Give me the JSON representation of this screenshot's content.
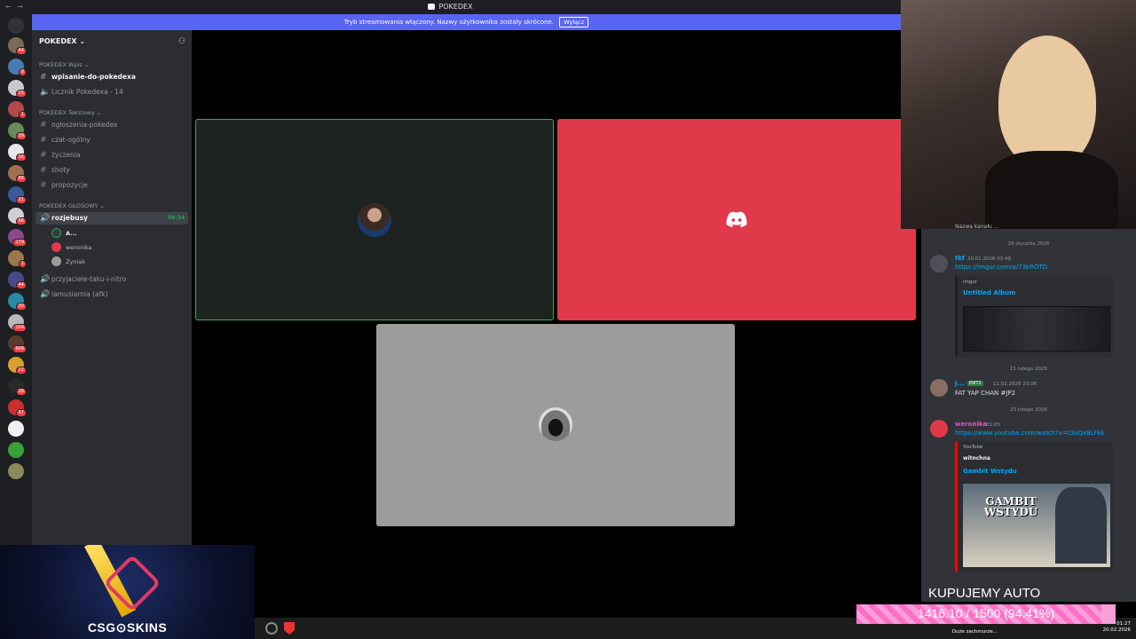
{
  "window": {
    "title": "POKEDEX"
  },
  "banner": {
    "text": "Tryb streamowania włączony. Nazwy użytkownika zostały skrócone.",
    "button": "Wyłącz"
  },
  "rail": {
    "badges": [
      "44",
      "8",
      "15",
      "1",
      "39",
      "16",
      "88",
      "31",
      "66",
      "179",
      "1",
      "44",
      "30",
      "104",
      "606",
      "22",
      "28",
      "57"
    ]
  },
  "sidebar": {
    "server_name": "POKEDEX",
    "categories": [
      {
        "label": "POKEDEX Wpis"
      },
      {
        "label": "POKEDEX Tekstowy"
      },
      {
        "label": "POKEDEX GŁOSOWY"
      }
    ],
    "channels": [
      {
        "label": "wpisanie-do-pokedexa"
      },
      {
        "label": "Licznik Pokedexa - 14"
      },
      {
        "label": "ogłoszenia-pokedex"
      },
      {
        "label": "czat-ogólny"
      },
      {
        "label": "życzenia"
      },
      {
        "label": "shoty"
      },
      {
        "label": "propozycje"
      }
    ],
    "voice_channels": [
      {
        "label": "rozjebusy",
        "time": "56:34"
      },
      {
        "label": "przyjaciele-taku-i-nitro"
      },
      {
        "label": "lamusiarnia (afk)"
      }
    ],
    "voice_users": [
      "A...",
      "weronika",
      "Żyniak"
    ]
  },
  "chat": {
    "top_text": "Nazwa kanału ...",
    "dates": [
      "20 stycznia 2026",
      "11 lutego 2026",
      "20 lutego 2026"
    ],
    "messages": [
      {
        "author": "tkf",
        "time": "20.01.2026 03:48",
        "link": "https://imgur.com/a/73kROTD",
        "embed_provider": "imgur",
        "embed_title": "Untitled Album"
      },
      {
        "author": "J...",
        "tag": "EMT2",
        "time": "11.02.2026 23:06",
        "text": "FAT YAP CHAN #JP2"
      },
      {
        "author": "weronika",
        "time": "01:03",
        "link": "https://www.youtube.com/watch?v=t3uQx8LFkk",
        "embed_provider": "YouTube",
        "embed_author": "witnchna",
        "embed_title": "Gambit Wstydu",
        "thumb_text": "GAMBIT WSTYDU"
      }
    ]
  },
  "overlays": {
    "skins_logo": "CSG⊙SKINS",
    "kupujemy": "KUPUJEMY AUTO",
    "goal_text": "1416.10 / 1500 (94.41%)",
    "goal_fraction": 0.9441,
    "tray_status": "Duże zachmurze...",
    "tray_time": "01:27",
    "tray_date": "20.02.2026"
  },
  "colors": {
    "blurple": "#5865f2",
    "discord_red": "#e0394a",
    "speaking_green": "#3ba55d",
    "link": "#00a8fc",
    "goal_pink": "#ff6ec7"
  }
}
